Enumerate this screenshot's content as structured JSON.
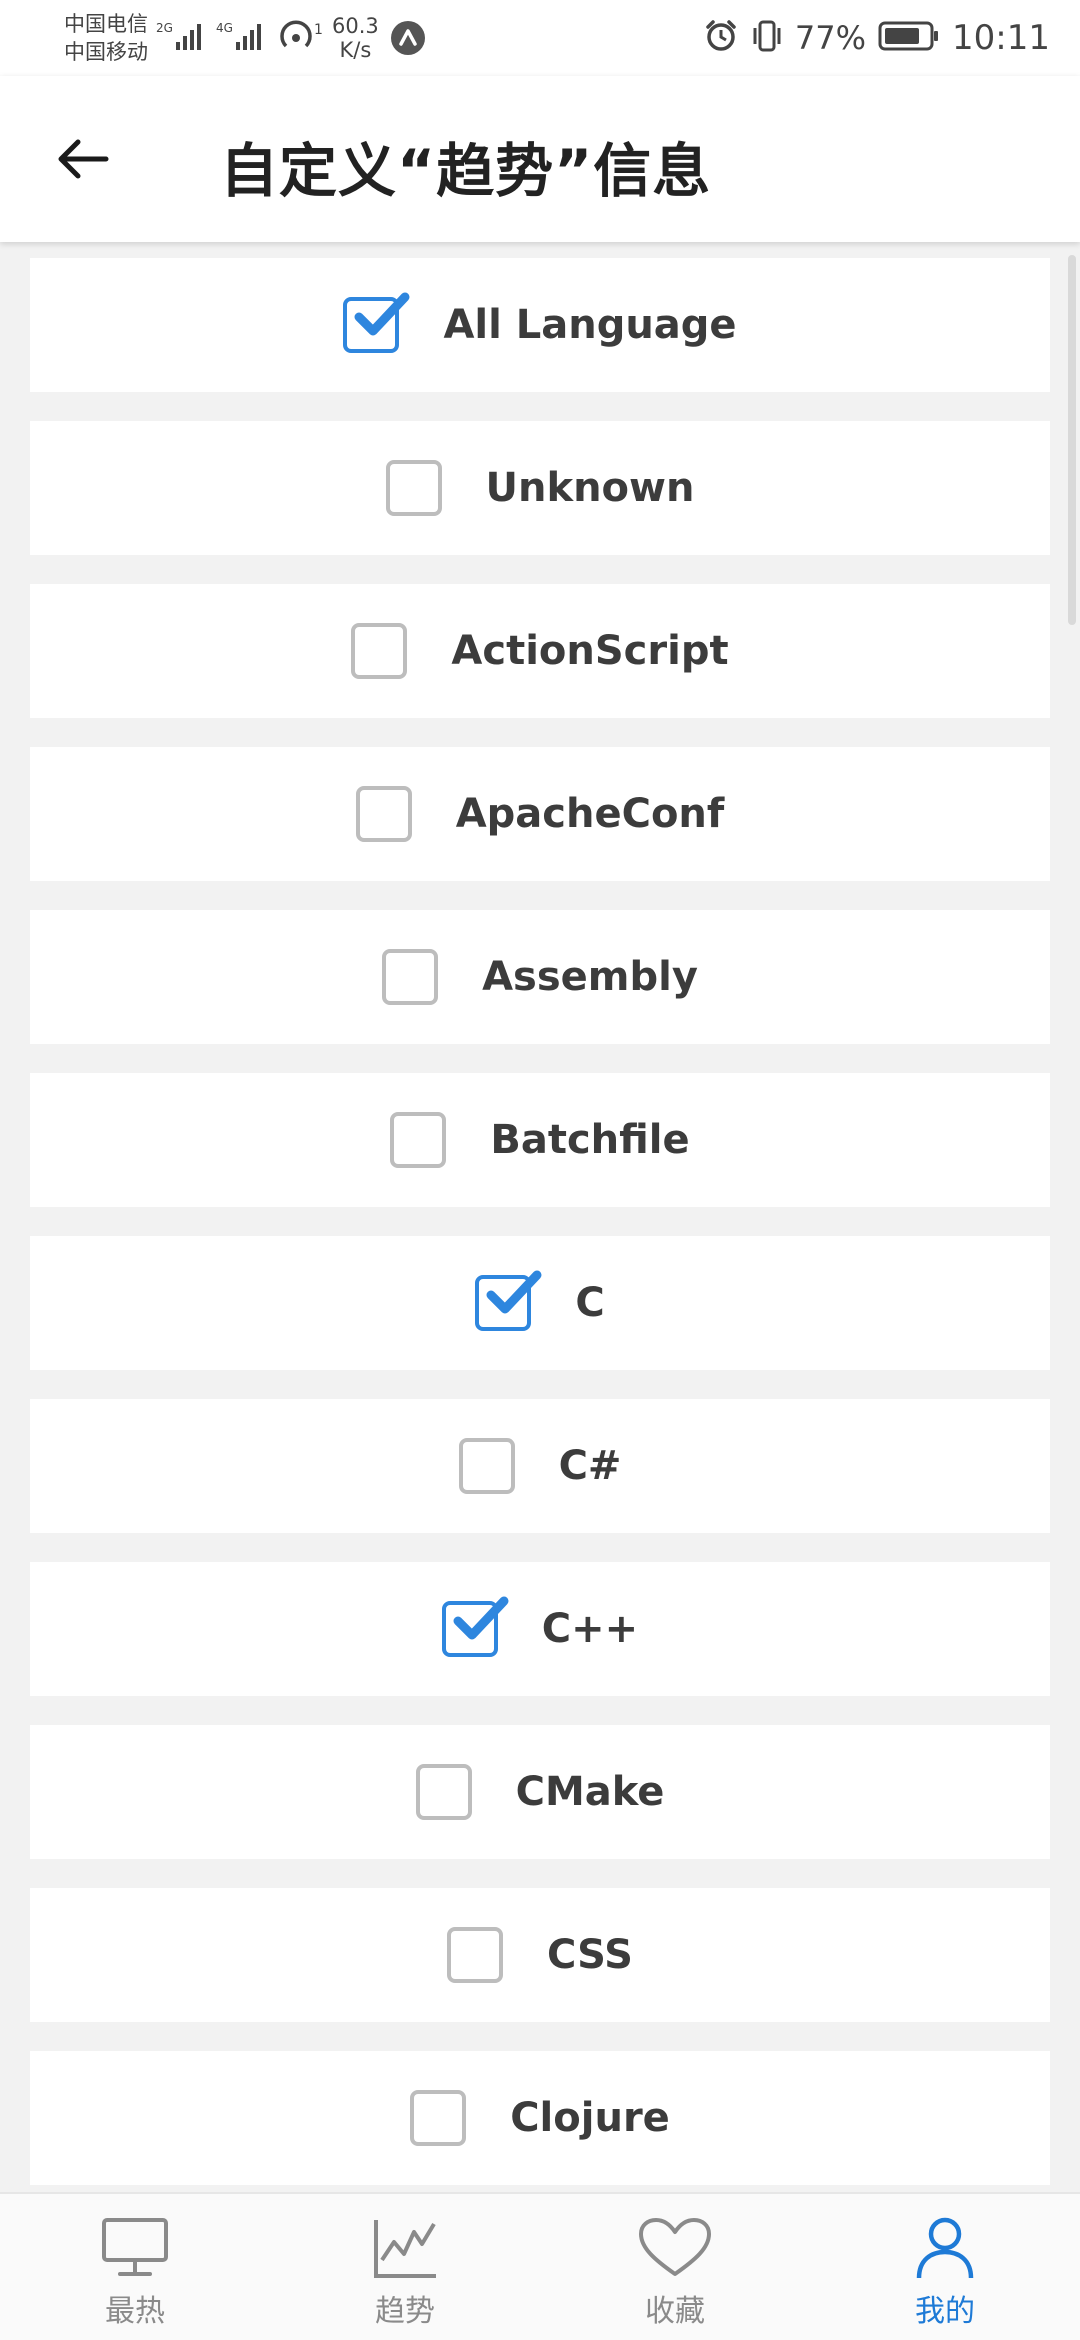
{
  "status_bar": {
    "carrier1": "中国电信",
    "carrier2": "中国移动",
    "sig1": "2G",
    "sig2": "4G",
    "hotspot_count": "1",
    "net_speed": "60.3",
    "net_unit": "K/s",
    "battery": "77%",
    "time": "10:11"
  },
  "header": {
    "title": "自定义“趋势”信息"
  },
  "languages": [
    {
      "label": "All Language",
      "checked": true
    },
    {
      "label": "Unknown",
      "checked": false
    },
    {
      "label": "ActionScript",
      "checked": false
    },
    {
      "label": "ApacheConf",
      "checked": false
    },
    {
      "label": "Assembly",
      "checked": false
    },
    {
      "label": "Batchfile",
      "checked": false
    },
    {
      "label": "C",
      "checked": true
    },
    {
      "label": "C#",
      "checked": false
    },
    {
      "label": "C++",
      "checked": true
    },
    {
      "label": "CMake",
      "checked": false
    },
    {
      "label": "CSS",
      "checked": false
    },
    {
      "label": "Clojure",
      "checked": false
    }
  ],
  "bottom_nav": {
    "hot": "最热",
    "trend": "趋势",
    "favorites": "收藏",
    "mine": "我的",
    "active": "mine"
  },
  "colors": {
    "accent": "#1e7ad6",
    "checkbox_checked": "#2e86de",
    "checkbox_unchecked": "#bdbdbd"
  }
}
